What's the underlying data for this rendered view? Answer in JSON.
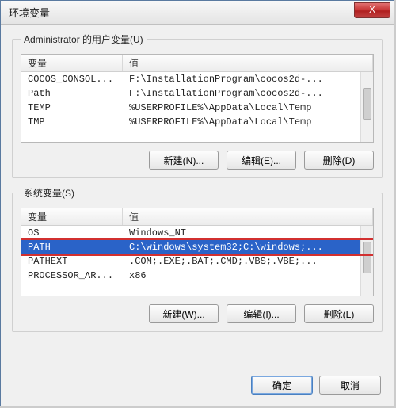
{
  "window": {
    "title": "环境变量"
  },
  "close": "X",
  "user_section": {
    "legend": "Administrator 的用户变量(U)",
    "columns": {
      "var": "变量",
      "val": "值"
    },
    "rows": [
      {
        "var": "COCOS_CONSOL...",
        "val": "F:\\InstallationProgram\\cocos2d-..."
      },
      {
        "var": "Path",
        "val": "F:\\InstallationProgram\\cocos2d-..."
      },
      {
        "var": "TEMP",
        "val": "%USERPROFILE%\\AppData\\Local\\Temp"
      },
      {
        "var": "TMP",
        "val": "%USERPROFILE%\\AppData\\Local\\Temp"
      }
    ],
    "buttons": {
      "new": "新建(N)...",
      "edit": "编辑(E)...",
      "delete": "删除(D)"
    }
  },
  "system_section": {
    "legend": "系统变量(S)",
    "columns": {
      "var": "变量",
      "val": "值"
    },
    "rows": [
      {
        "var": "OS",
        "val": "Windows_NT"
      },
      {
        "var": "PATH",
        "val": "C:\\windows\\system32;C:\\windows;..."
      },
      {
        "var": "PATHEXT",
        "val": ".COM;.EXE;.BAT;.CMD;.VBS;.VBE;..."
      },
      {
        "var": "PROCESSOR_AR...",
        "val": "x86"
      }
    ],
    "selected_index": 1,
    "buttons": {
      "new": "新建(W)...",
      "edit": "编辑(I)...",
      "delete": "删除(L)"
    }
  },
  "footer": {
    "ok": "确定",
    "cancel": "取消"
  }
}
